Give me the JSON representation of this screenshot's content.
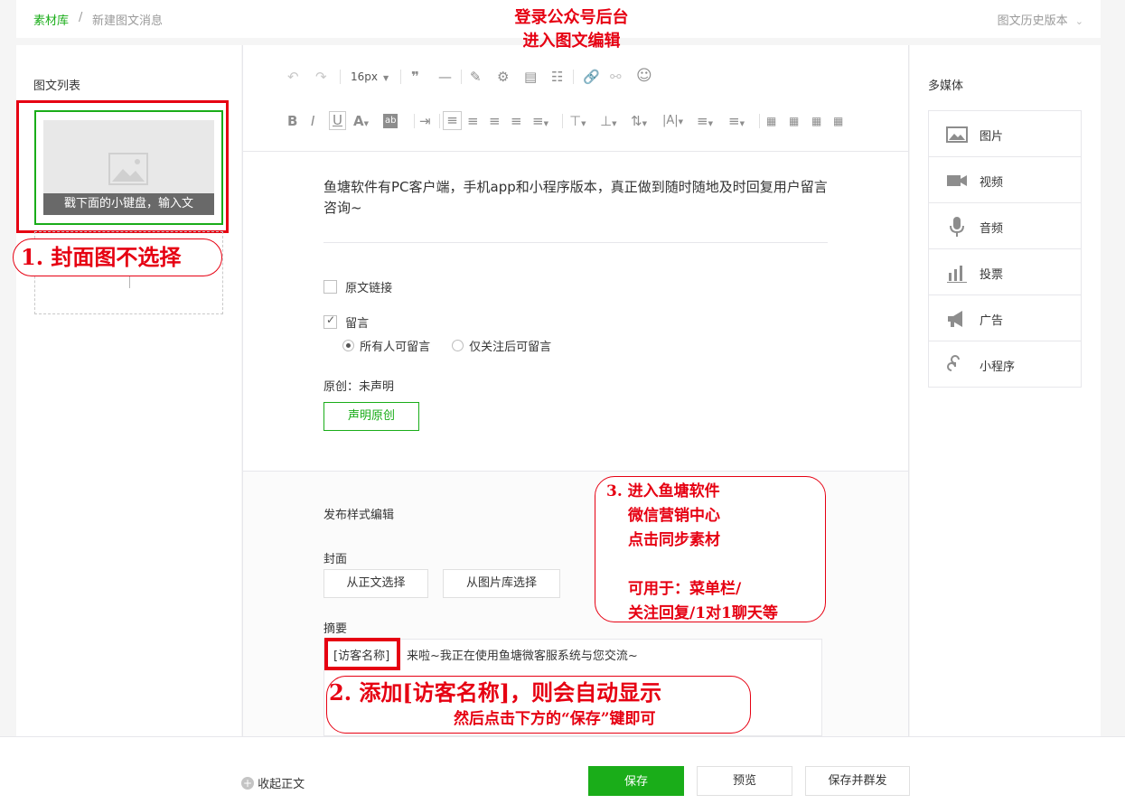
{
  "breadcrumb": {
    "root": "素材库",
    "separator": "/",
    "current": "新建图文消息"
  },
  "history_link": "图文历史版本",
  "annotations": {
    "top_line1": "登录公众号后台",
    "top_line2": "进入图文编辑",
    "step1": "1. 封面图不选择",
    "step2_line1": "2. 添加[访客名称]，则会自动显示",
    "step2_line2": "然后点击下方的“保存”键即可",
    "step3_lines": [
      "3. 进入鱼塘软件",
      "微信营销中心",
      "点击同步素材",
      "",
      "可用于：菜单栏/",
      "关注回复/1对1聊天等"
    ]
  },
  "left": {
    "title": "图文列表",
    "article_caption": "戳下面的小键盘，输入文"
  },
  "toolbar": {
    "font_size": "16px"
  },
  "editor": {
    "body_text": "鱼塘软件有PC客户端，手机app和小程序版本，真正做到随时随地及时回复用户留言咨询~",
    "original_link_label": "原文链接",
    "comment_label": "留言",
    "comment_option_all": "所有人可留言",
    "comment_option_followers": "仅关注后可留言",
    "original_status": "原创：未声明",
    "declare_button": "声明原创",
    "publish_style_title": "发布样式编辑",
    "cover_label": "封面",
    "cover_from_text_button": "从正文选择",
    "cover_from_library_button": "从图片库选择",
    "summary_label": "摘要",
    "summary_tag": "[访客名称]",
    "summary_text": "来啦~我正在使用鱼塘微客服系统与您交流~"
  },
  "media": {
    "title": "多媒体",
    "items": [
      {
        "label": "图片",
        "icon": "image-icon"
      },
      {
        "label": "视频",
        "icon": "video-icon"
      },
      {
        "label": "音频",
        "icon": "audio-icon"
      },
      {
        "label": "投票",
        "icon": "vote-icon"
      },
      {
        "label": "广告",
        "icon": "ad-icon"
      },
      {
        "label": "小程序",
        "icon": "miniprogram-icon"
      }
    ]
  },
  "bottom": {
    "collapse_label": "收起正文",
    "save_button": "保存",
    "preview_button": "预览",
    "save_and_send_button": "保存并群发"
  },
  "colors": {
    "accent_green": "#1aad19",
    "annotation_red": "#e60012"
  }
}
